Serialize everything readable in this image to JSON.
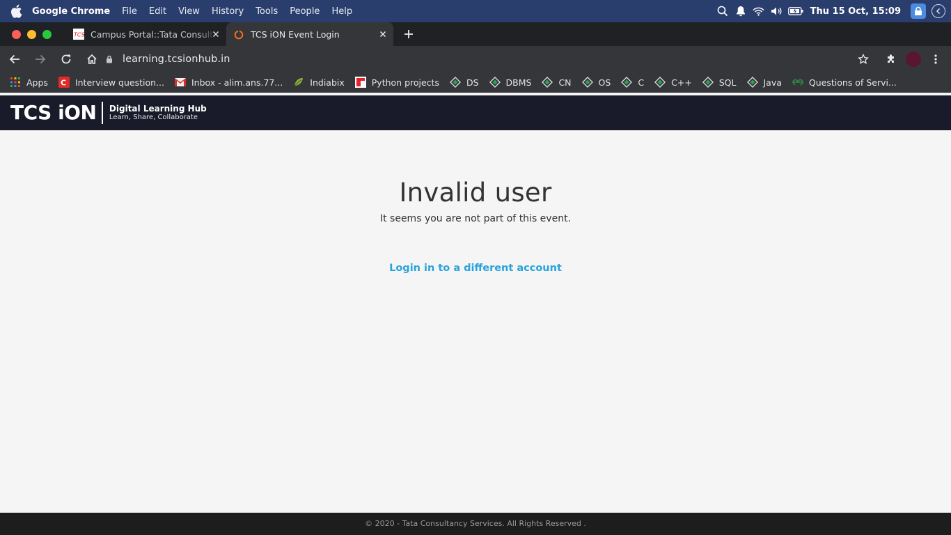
{
  "menubar": {
    "app_name": "Google Chrome",
    "menus": [
      "File",
      "Edit",
      "View",
      "History",
      "Tools",
      "People",
      "Help"
    ],
    "clock": "Thu 15 Oct, 15:09"
  },
  "tabs": [
    {
      "title": "Campus Portal::Tata Consultancy",
      "favicon": "tcs-favicon",
      "active": false
    },
    {
      "title": "TCS iON Event Login",
      "favicon": "tcs-ion-favicon",
      "active": true
    }
  ],
  "address_bar": {
    "url": "learning.tcsionhub.in"
  },
  "bookmarks": [
    {
      "label": "Apps",
      "icon": "apps-grid-icon"
    },
    {
      "label": "Interview question...",
      "icon": "c-logo-icon"
    },
    {
      "label": "Inbox - alim.ans.77...",
      "icon": "gmail-icon"
    },
    {
      "label": "Indiabix",
      "icon": "indiabix-icon"
    },
    {
      "label": "Python projects",
      "icon": "python-projects-icon"
    },
    {
      "label": "DS",
      "icon": "hackerrank-icon"
    },
    {
      "label": "DBMS",
      "icon": "hackerrank-icon"
    },
    {
      "label": "CN",
      "icon": "hackerrank-icon"
    },
    {
      "label": "OS",
      "icon": "hackerrank-icon"
    },
    {
      "label": "C",
      "icon": "hackerrank-icon"
    },
    {
      "label": "C++",
      "icon": "hackerrank-icon"
    },
    {
      "label": "SQL",
      "icon": "hackerrank-icon"
    },
    {
      "label": "Java",
      "icon": "hackerrank-icon"
    },
    {
      "label": "Questions of Servi...",
      "icon": "geeksforgeeks-icon"
    }
  ],
  "site_header": {
    "brand": "TCS iON",
    "hub_title": "Digital Learning Hub",
    "tagline": "Learn, Share, Collaborate"
  },
  "main": {
    "heading": "Invalid user",
    "message": "It seems you are not part of this event.",
    "link_label": "Login in to a different account"
  },
  "footer": {
    "text": "© 2020 - Tata Consultancy Services. All Rights Reserved ."
  },
  "colors": {
    "menubar_bg": "#2a3e6e",
    "chrome_dark": "#35363a",
    "site_header_bg": "#1a1b2a",
    "link": "#29a3db",
    "footer_bg": "#1d1d1d"
  }
}
